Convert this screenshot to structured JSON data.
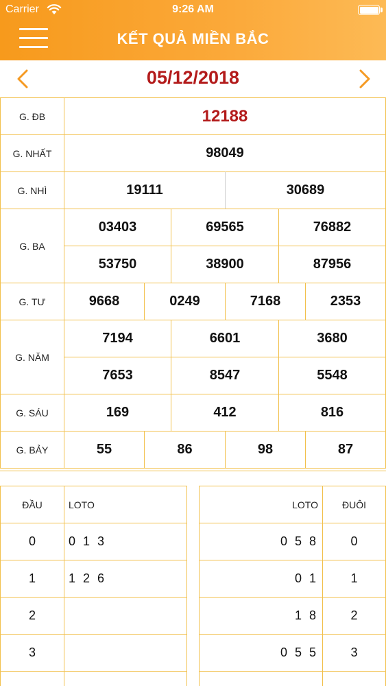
{
  "status_bar": {
    "carrier": "Carrier",
    "time": "9:26 AM"
  },
  "header": {
    "title": "KẾT QUẢ MIỀN BẮC"
  },
  "date_nav": {
    "date": "05/12/2018"
  },
  "results": {
    "dac_biet": {
      "label": "G. ĐB",
      "values": [
        "12188"
      ]
    },
    "nhat": {
      "label": "G. NHẤT",
      "values": [
        "98049"
      ]
    },
    "nhi": {
      "label": "G. NHÌ",
      "values": [
        "19111",
        "30689"
      ]
    },
    "ba": {
      "label": "G. BA",
      "values": [
        "03403",
        "69565",
        "76882",
        "53750",
        "38900",
        "87956"
      ]
    },
    "tu": {
      "label": "G. TƯ",
      "values": [
        "9668",
        "0249",
        "7168",
        "2353"
      ]
    },
    "nam": {
      "label": "G. NĂM",
      "values": [
        "7194",
        "6601",
        "3680",
        "7653",
        "8547",
        "5548"
      ]
    },
    "sau": {
      "label": "G. SÁU",
      "values": [
        "169",
        "412",
        "816"
      ]
    },
    "bay": {
      "label": "G. BẢY",
      "values": [
        "55",
        "86",
        "98",
        "87"
      ]
    }
  },
  "loto_dau": {
    "headers": [
      "ĐẦU",
      "LOTO"
    ],
    "rows": [
      {
        "key": "0",
        "loto": "0 1 3"
      },
      {
        "key": "1",
        "loto": "1 2 6"
      },
      {
        "key": "2",
        "loto": ""
      },
      {
        "key": "3",
        "loto": ""
      }
    ]
  },
  "loto_duoi": {
    "headers": [
      "LOTO",
      "ĐUÔI"
    ],
    "rows": [
      {
        "loto": "0 5 8",
        "key": "0"
      },
      {
        "loto": "0 1",
        "key": "1"
      },
      {
        "loto": "1 8",
        "key": "2"
      },
      {
        "loto": "0 5 5",
        "key": "3"
      }
    ]
  }
}
